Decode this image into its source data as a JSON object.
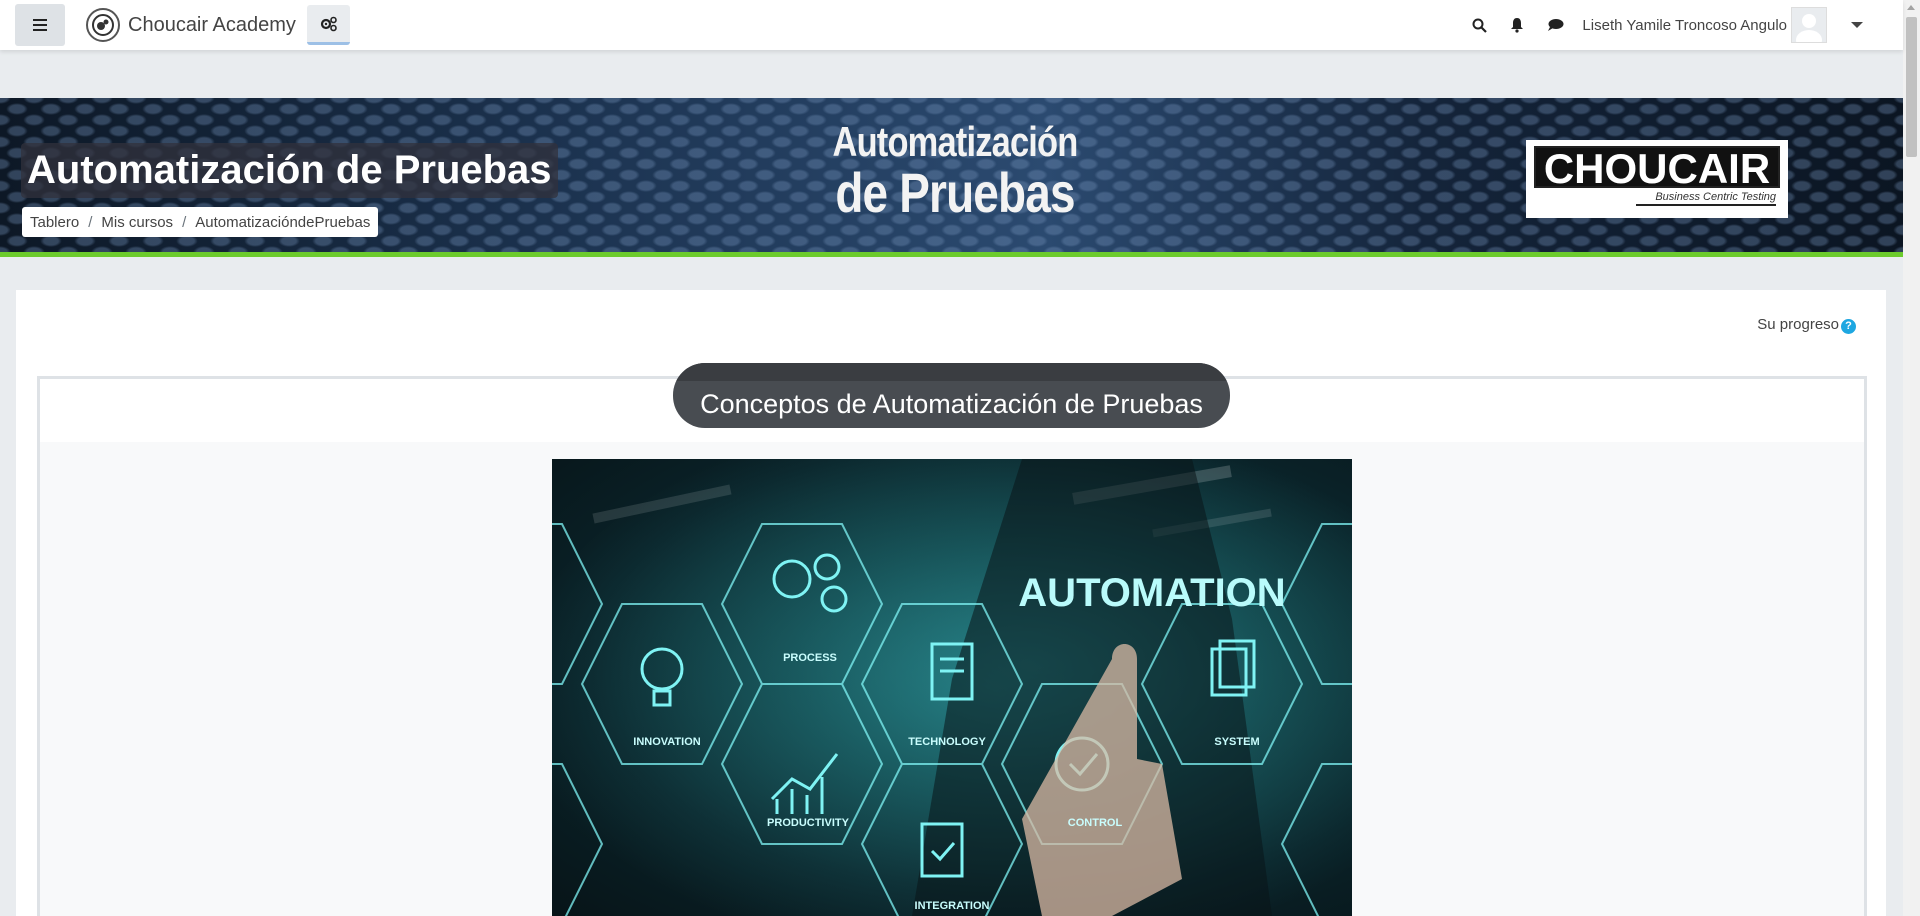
{
  "navbar": {
    "site_name": "Choucair Academy",
    "user_name": "Liseth Yamile Troncoso Angulo"
  },
  "banner": {
    "course_title": "Automatización de Pruebas",
    "image_text_line1": "Automatización",
    "image_text_line2": "de Pruebas",
    "logo_text": "CHOUCAIR",
    "logo_tagline": "Business Centric Testing",
    "accent_color": "#6ccb2c"
  },
  "breadcrumb": {
    "items": [
      "Tablero",
      "Mis cursos",
      "AutomatizacióndePruebas"
    ]
  },
  "main": {
    "progress_label": "Su progreso",
    "section_title": "Conceptos de Automatización de Pruebas",
    "hero_image": {
      "headline": "AUTOMATION",
      "labels": [
        "PROCESS",
        "INNOVATION",
        "TECHNOLOGY",
        "SYSTEM",
        "PRODUCTIVITY",
        "CONTROL",
        "INTEGRATION"
      ]
    }
  }
}
